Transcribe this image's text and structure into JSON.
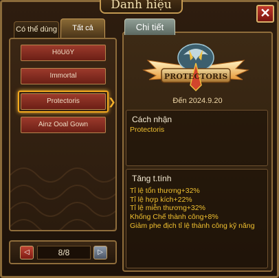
{
  "window": {
    "title": "Danh hiệu",
    "close_label": "✕"
  },
  "tabs": [
    {
      "label": "Có thể dùng"
    },
    {
      "label": "Tất cả"
    }
  ],
  "title_list": [
    {
      "label": "HöUöY"
    },
    {
      "label": "Immortal"
    },
    {
      "label": "Protectoris"
    },
    {
      "label": "Ainz Ooal Gown"
    }
  ],
  "pager": {
    "prev_label": "◁",
    "page": "8/8",
    "next_label": "▷"
  },
  "detail": {
    "tab_label": "Chi tiết",
    "emblem_text": "PROTECTORIS",
    "date": "Đến 2024.9.20",
    "how_to_get": {
      "heading": "Cách nhận",
      "value": "Protectoris"
    },
    "stats": {
      "heading": "Tăng t.tính",
      "lines": [
        "Tỉ lệ tổn thương+32%",
        "Tỉ lệ hợp kích+22%",
        "Tỉ lệ miễn thương+32%",
        "Khống Chế thành công+8%",
        "Giảm phe địch tỉ lệ thành công kỹ năng"
      ]
    }
  },
  "colors": {
    "accent": "#f3a81d",
    "stat_text": "#f0c030",
    "item_red": "#9c3a2c"
  }
}
